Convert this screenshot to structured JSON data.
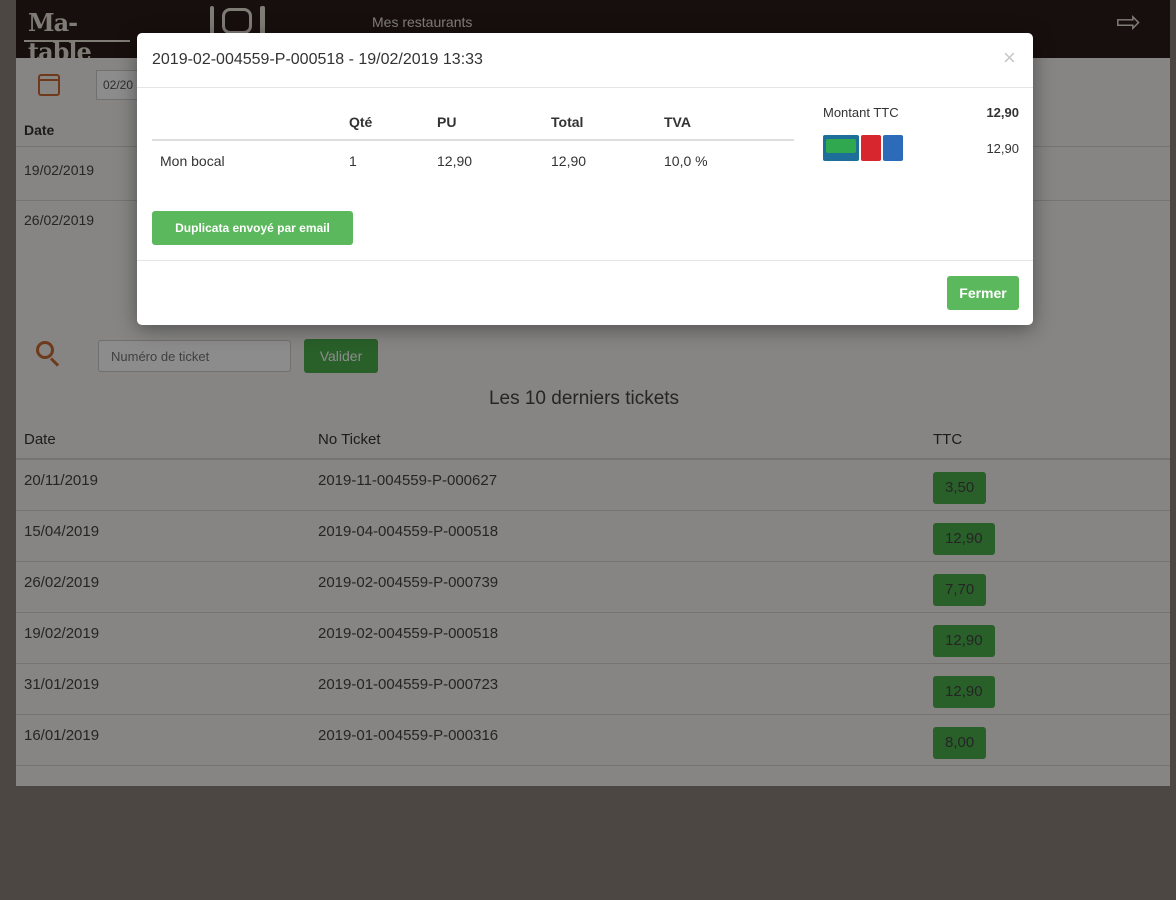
{
  "header": {
    "logo_text": "Ma-table",
    "nav_label": "Mes restaurants"
  },
  "filter": {
    "date_value": "02/20"
  },
  "top_table": {
    "date_header": "Date",
    "rows": [
      "19/02/2019",
      "26/02/2019"
    ]
  },
  "search": {
    "placeholder": "Numéro de ticket",
    "validate_label": "Valider"
  },
  "tickets": {
    "title": "Les 10 derniers tickets",
    "headers": {
      "date": "Date",
      "number": "No Ticket",
      "ttc": "TTC"
    },
    "rows": [
      {
        "date": "20/11/2019",
        "number": "2019-11-004559-P-000627",
        "ttc": "3,50"
      },
      {
        "date": "15/04/2019",
        "number": "2019-04-004559-P-000518",
        "ttc": "12,90"
      },
      {
        "date": "26/02/2019",
        "number": "2019-02-004559-P-000739",
        "ttc": "7,70"
      },
      {
        "date": "19/02/2019",
        "number": "2019-02-004559-P-000518",
        "ttc": "12,90"
      },
      {
        "date": "31/01/2019",
        "number": "2019-01-004559-P-000723",
        "ttc": "12,90"
      },
      {
        "date": "16/01/2019",
        "number": "2019-01-004559-P-000316",
        "ttc": "8,00"
      }
    ]
  },
  "modal": {
    "title": "2019-02-004559-P-000518 - 19/02/2019 13:33",
    "close_glyph": "×",
    "columns": {
      "item": "",
      "qty": "Qté",
      "pu": "PU",
      "total": "Total",
      "tva": "TVA"
    },
    "lines": [
      {
        "item": "Mon bocal",
        "qty": "1",
        "pu": "12,90",
        "total": "12,90",
        "tva": "10,0 %"
      }
    ],
    "payment": {
      "label": "Montant TTC",
      "amount": "12,90",
      "card_amount": "12,90",
      "card_icon": "credit-cards-icon"
    },
    "duplicate_label": "Duplicata envoyé par email",
    "close_label": "Fermer"
  },
  "colors": {
    "header_bg": "#2b1d1a",
    "accent_green": "#5cb85c",
    "icon_orange": "#c96b32"
  }
}
